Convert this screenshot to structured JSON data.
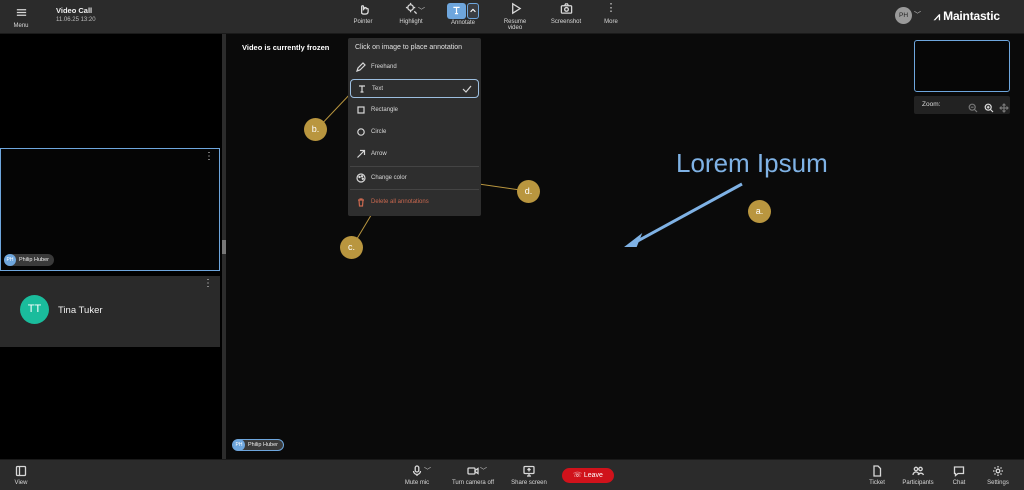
{
  "header": {
    "menu_label": "Menu",
    "title": "Video Call",
    "datetime": "11.06.25  13:20",
    "tools": {
      "pointer": "Pointer",
      "highlight": "Highlight",
      "annotate": "Annotate",
      "resume_video": "Resume video",
      "screenshot": "Screenshot",
      "more": "More"
    },
    "user_initials": "PH",
    "brand": "Maintastic"
  },
  "participants": {
    "local": {
      "initials": "PH",
      "name": "Philip Huber"
    },
    "remote": {
      "initials": "TT",
      "name": "Tina Tuker",
      "avatar_color": "#1abc9c"
    }
  },
  "main": {
    "status": "Video is currently frozen",
    "annotation_text": "Lorem Ipsum",
    "presenter_chip": {
      "initials": "PH",
      "name": "Philip Huber"
    }
  },
  "annotate_menu": {
    "title": "Click on image to place annotation",
    "items": [
      {
        "label": "Freehand",
        "icon": "pencil-icon"
      },
      {
        "label": "Text",
        "icon": "text-icon",
        "selected": true
      },
      {
        "label": "Rectangle",
        "icon": "rectangle-icon"
      },
      {
        "label": "Circle",
        "icon": "circle-icon"
      },
      {
        "label": "Arrow",
        "icon": "arrow-icon"
      }
    ],
    "change_color": "Change color",
    "delete_all": "Delete all annotations"
  },
  "callouts": {
    "a": "a.",
    "b": "b.",
    "c": "c.",
    "d": "d."
  },
  "zoom": {
    "label": "Zoom:"
  },
  "footer": {
    "view": "View",
    "mute_mic": "Mute mic",
    "camera_off": "Turn camera off",
    "share_screen": "Share screen",
    "leave": "Leave",
    "ticket": "Ticket",
    "participants": "Participants",
    "chat": "Chat",
    "settings": "Settings"
  },
  "colors": {
    "accent": "#6ea6dd",
    "leave": "#d0121b",
    "callout": "#b9963f",
    "danger": "#c9684f"
  }
}
